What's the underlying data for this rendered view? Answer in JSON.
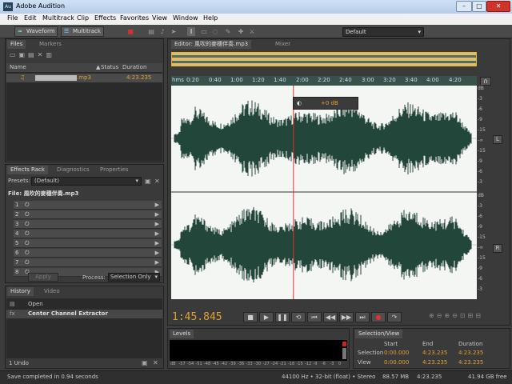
{
  "window": {
    "title": "Adobe Audition",
    "app_icon": "Au",
    "buttons": {
      "minimize": "–",
      "restore": "□",
      "close": "✕"
    }
  },
  "menu": [
    "File",
    "Edit",
    "Multitrack",
    "Clip",
    "Effects",
    "Favorites",
    "View",
    "Window",
    "Help"
  ],
  "toolbar": {
    "waveform_label": "Waveform",
    "multitrack_label": "Multitrack",
    "workspace": "Default"
  },
  "files_panel": {
    "tab_files": "Files",
    "tab_markers": "Markers",
    "col_name": "Name",
    "col_status": "Status",
    "col_duration": "Duration",
    "file_name_suffix": ".mp3",
    "file_duration": "4:23.235"
  },
  "effects_rack": {
    "tab_effects": "Effects Rack",
    "tab_diagnostics": "Diagnostics",
    "tab_properties": "Properties",
    "presets_label": "Presets:",
    "presets_value": "(Default)",
    "file_label": "File: 風吹的麥穗伴奏.mp3",
    "slots": [
      "1",
      "2",
      "3",
      "4",
      "5",
      "6",
      "7",
      "8"
    ],
    "apply_label": "Apply",
    "process_label": "Process:",
    "process_value": "Selection Only"
  },
  "history": {
    "tab_history": "History",
    "tab_video": "Video",
    "items": [
      "Open",
      "Center Channel Extractor"
    ],
    "undo_count": "1 Undo"
  },
  "editor": {
    "tab_editor": "Editor: 風吹的麥穗伴奏.mp3",
    "tab_mixer": "Mixer",
    "ruler_labels": [
      "hms",
      "0:20",
      "0:40",
      "1:00",
      "1:20",
      "1:40",
      "2:00",
      "2:20",
      "2:40",
      "3:00",
      "3:20",
      "3:40",
      "4:00",
      "4:20"
    ],
    "db_labels_top": [
      "dB",
      "-3",
      "-6",
      "-9",
      "-15",
      "-∞",
      "-15",
      "-9",
      "-6",
      "-3"
    ],
    "db_labels_bottom": [
      "dB",
      "-3",
      "-6",
      "-9",
      "-15",
      "-∞",
      "-15",
      "-9",
      "-6",
      "-3"
    ],
    "channel_top": "L",
    "channel_bottom": "R",
    "hud_db": "+0 dB",
    "playhead_fraction": 0.4,
    "waveform_color": "#23463a",
    "playhead_color": "#e03030"
  },
  "transport": {
    "time": "1:45.845",
    "time_color": "#e0a030"
  },
  "levels": {
    "tab": "Levels",
    "scale": [
      "dB",
      "-57",
      "-54",
      "-51",
      "-48",
      "-45",
      "-42",
      "-39",
      "-36",
      "-33",
      "-30",
      "-27",
      "-24",
      "-21",
      "-18",
      "-15",
      "-12",
      "-9",
      "-6",
      "-3",
      "0"
    ]
  },
  "selection_view": {
    "tab": "Selection/View",
    "col_start": "Start",
    "col_end": "End",
    "col_duration": "Duration",
    "row_selection": "Selection",
    "row_view": "View",
    "selection": [
      "0:00.000",
      "4:23.235",
      "4:23.235"
    ],
    "view": [
      "0:00.000",
      "4:23.235",
      "4:23.235"
    ]
  },
  "status_bar": {
    "message": "Save completed in 0.94 seconds",
    "format": "44100 Hz • 32-bit (float) • Stereo",
    "size": "88.57 MB",
    "duration": "4:23.235",
    "free": "41.94 GB free"
  }
}
